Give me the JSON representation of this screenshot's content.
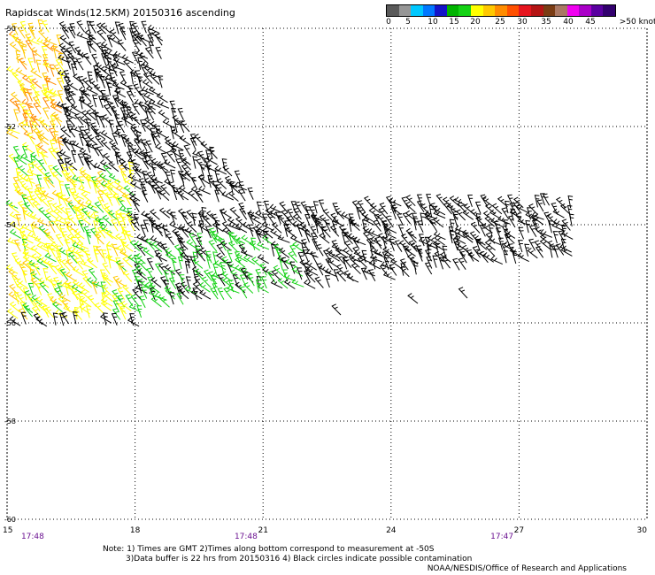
{
  "title": "Rapidscat Winds(12.5KM) 20150316 ascending",
  "colorbar": {
    "colors": [
      "#5a5a5a",
      "#969696",
      "#00c8ff",
      "#0078ff",
      "#1414c8",
      "#00b400",
      "#14d214",
      "#ffff00",
      "#ffc800",
      "#ff8c00",
      "#ff5000",
      "#e6141e",
      "#b41414",
      "#7a3c14",
      "#aa7864",
      "#f000f0",
      "#aa00c8",
      "#5a00a0",
      "#32006e"
    ],
    "labels": [
      "0",
      "5",
      "10",
      "15",
      "20",
      "25",
      "30",
      "35",
      "40",
      "45",
      ">50 knots"
    ]
  },
  "map": {
    "lon_range": [
      15,
      30
    ],
    "lat_range": [
      -60,
      -50
    ],
    "lon_ticks": [
      "15",
      "18",
      "21",
      "24",
      "27",
      "30"
    ],
    "lat_ticks": [
      "-50",
      "-52",
      "-54",
      "-56",
      "-58",
      "-60"
    ],
    "grid": "dotted",
    "time_labels": [
      {
        "text": "17:48",
        "lon": 15.6
      },
      {
        "text": "17:48",
        "lon": 20.6
      },
      {
        "text": "17:47",
        "lon": 26.6
      }
    ]
  },
  "notes": [
    "Note: 1) Times are GMT 2)Times along bottom correspond to measurement at -50S",
    "3)Data buffer is 22 hrs from 20150316 4) Black circles indicate possible contamination"
  ],
  "credit": "NOAA/NESDIS/Office of Research and Applications"
}
